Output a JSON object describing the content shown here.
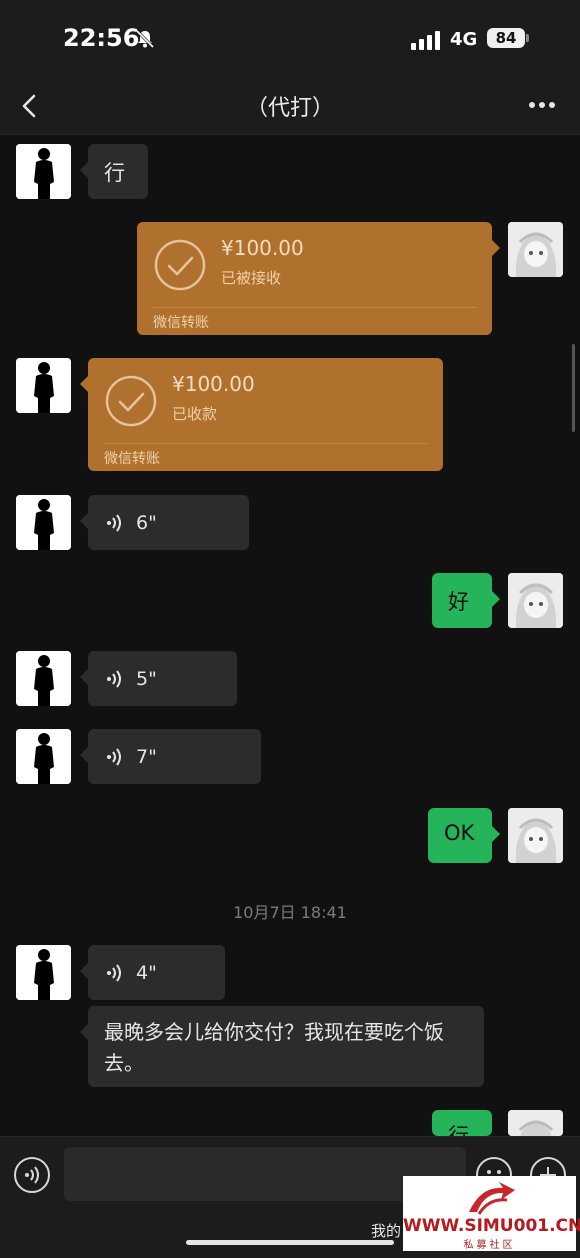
{
  "status_bar": {
    "time": "22:56",
    "network": "4G",
    "battery": "84"
  },
  "nav": {
    "title": "（代打）"
  },
  "messages": {
    "m1_text": "行",
    "m2_amount": "¥100.00",
    "m2_status": "已被接收",
    "m2_source": "微信转账",
    "m3_amount": "¥100.00",
    "m3_status": "已收款",
    "m3_source": "微信转账",
    "m4_duration": "6\"",
    "m5_text": "好",
    "m6_duration": "5\"",
    "m7_duration": "7\"",
    "m8_text": "OK",
    "timestamp": "10月7日 18:41",
    "m9_duration": "4\"",
    "m10_text": "最晚多会儿给你交付？我现在要吃个饭去。",
    "m11_text": "行"
  },
  "input_bar": {
    "placeholder": ""
  },
  "overlay": {
    "my_label": "我的",
    "watermark_url": "WWW.SIMU001.CN",
    "watermark_sub": "私募社区"
  },
  "colors": {
    "background": "#111111",
    "transfer": "#b0712f",
    "my_bubble": "#25b45a",
    "other_bubble": "#2c2c2c"
  }
}
